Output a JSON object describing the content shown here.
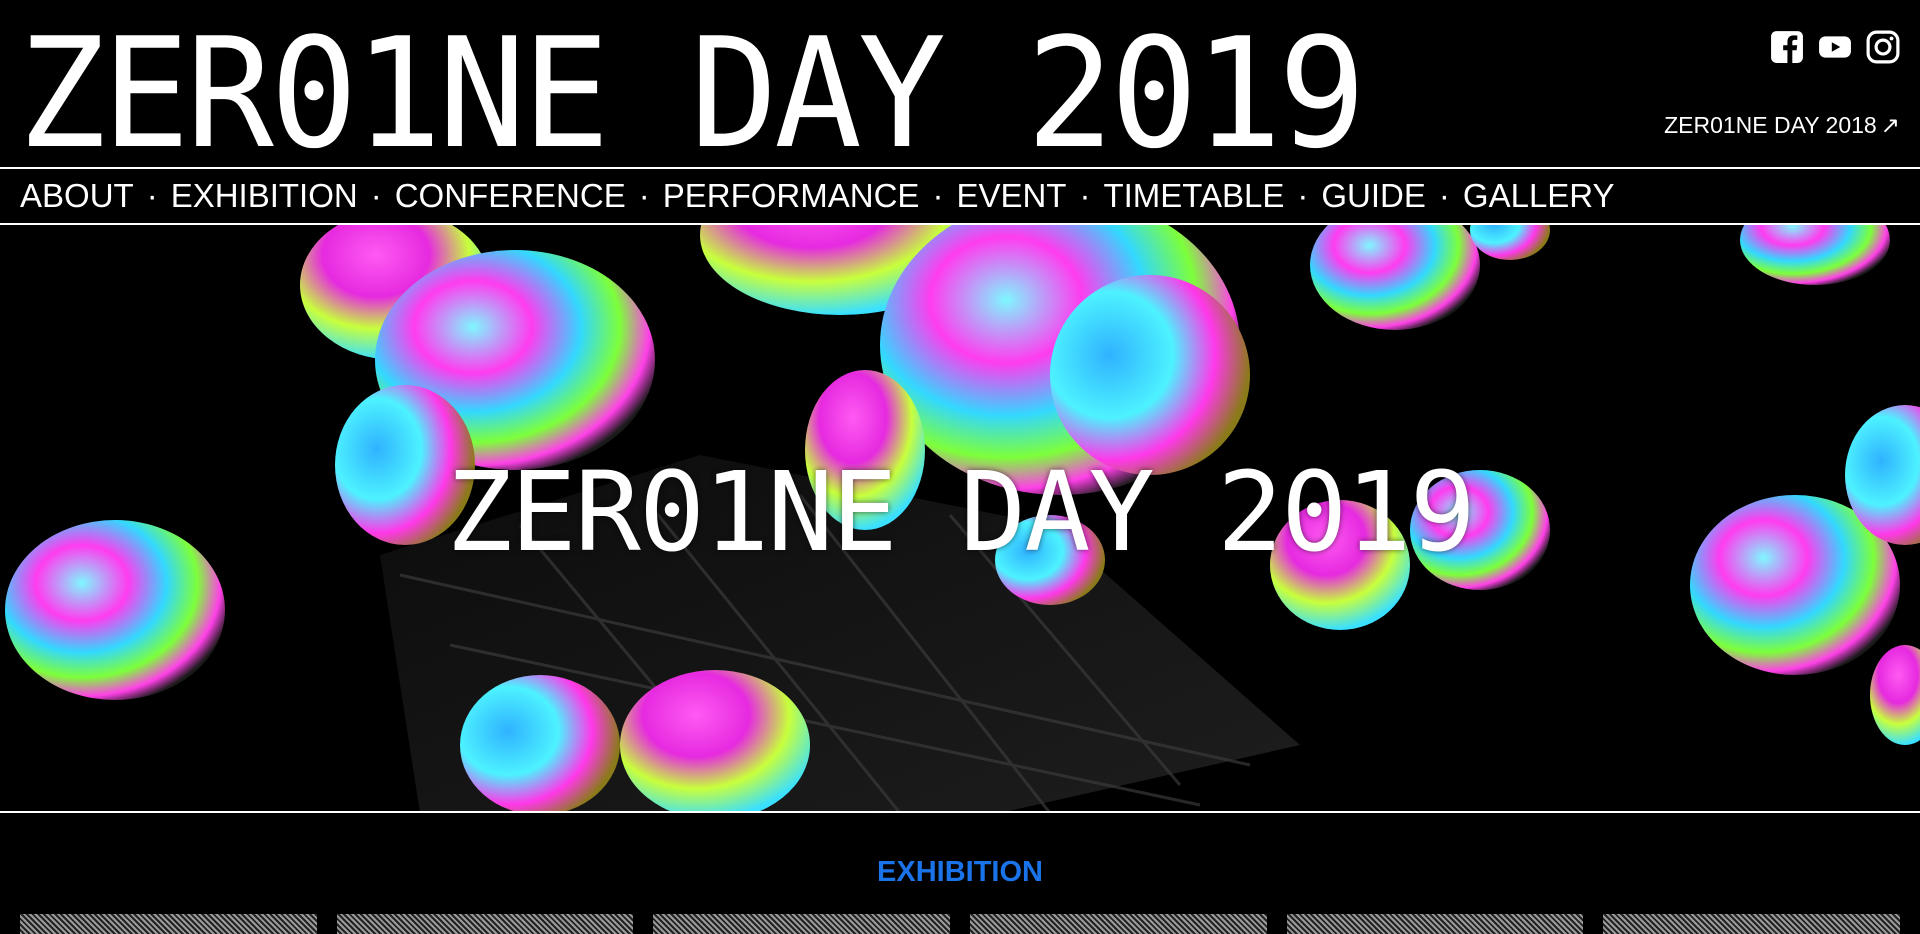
{
  "site": {
    "logo": "ZER01NE DAY 2019",
    "prev_year_link": "ZER01NE DAY 2018",
    "prev_year_arrow": "↗"
  },
  "social": [
    {
      "name": "facebook-icon"
    },
    {
      "name": "youtube-icon"
    },
    {
      "name": "instagram-icon"
    }
  ],
  "nav": {
    "items": [
      "ABOUT",
      "EXHIBITION",
      "CONFERENCE",
      "PERFORMANCE",
      "EVENT",
      "TIMETABLE",
      "GUIDE",
      "GALLERY"
    ],
    "separator": "·"
  },
  "hero": {
    "title": "ZER01NE DAY 2019"
  },
  "section": {
    "title": "EXHIBITION"
  },
  "colors": {
    "background": "#000000",
    "text": "#ffffff",
    "accent": "#1a73e8"
  }
}
